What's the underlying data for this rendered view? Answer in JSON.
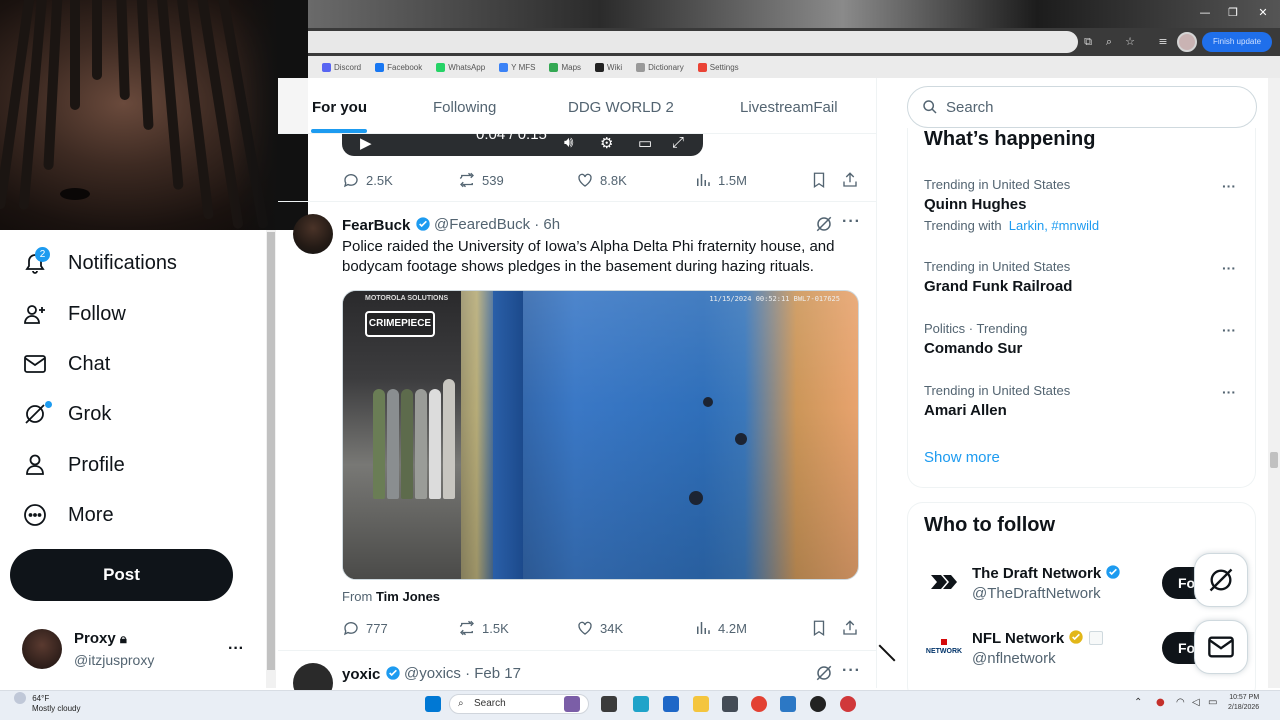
{
  "browser": {
    "bookmarks": [
      {
        "label": "Discord",
        "color": "#5865f2"
      },
      {
        "label": "Facebook",
        "color": "#1877f2"
      },
      {
        "label": "WhatsApp",
        "color": "#25d366"
      },
      {
        "label": "Y MFS",
        "color": "#3b82f6"
      },
      {
        "label": "Maps",
        "color": "#34a853"
      },
      {
        "label": "Wiki",
        "color": "#222222"
      },
      {
        "label": "Dictionary",
        "color": "#999999"
      },
      {
        "label": "Settings",
        "color": "#ea4335"
      }
    ],
    "finish_update": "Finish update"
  },
  "nav": {
    "notifications": "Notifications",
    "notifications_badge": "2",
    "follow": "Follow",
    "chat": "Chat",
    "grok": "Grok",
    "profile": "Profile",
    "more": "More",
    "post": "Post"
  },
  "account": {
    "name": "Proxy",
    "handle": "@itzjusproxy"
  },
  "tabs": [
    "For you",
    "Following",
    "DDG WORLD 2",
    "LivestreamFail"
  ],
  "prev_tweet": {
    "video_time": "0:04 / 0:15",
    "replies": "2.5K",
    "reposts": "539",
    "likes": "8.8K",
    "views": "1.5M"
  },
  "tweet": {
    "author": "FearBuck",
    "meta": "@FearedBuck · 6h",
    "text": "Police raided the University of Iowa’s Alpha Delta Phi fraternity house, and bodycam footage shows pledges in the basement during hazing rituals.",
    "media_brand": "MOTOROLA SOLUTIONS",
    "media_timestamp": "11/15/2024 00:52:11   BWL7-017625",
    "media_badge": "CRIMEPIECE",
    "from_label": "From",
    "from_name": "Tim Jones",
    "replies": "777",
    "reposts": "1.5K",
    "likes": "34K",
    "views": "4.2M"
  },
  "next_tweet": {
    "author": "yoxic",
    "meta": "@yoxics · Feb 17"
  },
  "search_placeholder": "Search",
  "happening": {
    "title": "What’s happening",
    "items": [
      {
        "context": "Trending in United States",
        "name": "Quinn Hughes",
        "with_label": "Trending with",
        "with_links": "Larkin, #mnwild"
      },
      {
        "context": "Trending in United States",
        "name": "Grand Funk Railroad"
      },
      {
        "context": "Politics · Trending",
        "name": "Comando Sur"
      },
      {
        "context": "Trending in United States",
        "name": "Amari Allen"
      }
    ],
    "show_more": "Show more"
  },
  "who_to_follow": {
    "title": "Who to follow",
    "accounts": [
      {
        "name": "The Draft Network",
        "handle": "@TheDraftNetwork",
        "button": "Fo"
      },
      {
        "name": "NFL Network",
        "handle": "@nflnetwork",
        "button": "Fo"
      }
    ]
  },
  "taskbar": {
    "weather_temp": "64°F",
    "weather_desc": "Mostly cloudy",
    "search": "Search",
    "time": "10:57 PM",
    "date": "2/18/2026"
  }
}
